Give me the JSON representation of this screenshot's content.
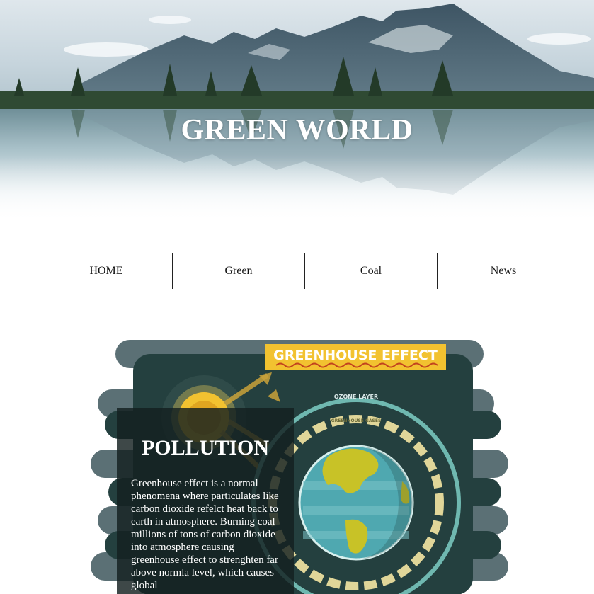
{
  "header": {
    "title": "GREEN WORLD"
  },
  "nav": {
    "items": [
      {
        "label": "HOME"
      },
      {
        "label": "Green"
      },
      {
        "label": "Coal"
      },
      {
        "label": "News"
      }
    ]
  },
  "infographic": {
    "banner": "GREENHOUSE EFFECT",
    "ozone_label": "OZONE LAYER",
    "gases_label": "GREENHOUSE GASES"
  },
  "article": {
    "title": "POLLUTION",
    "body": "Greenhouse effect is a normal phenomena where particulates like carbon dioxide refelct heat back to earth in atmosphere. Burning coal millions of tons of carbon dioxide into atmosphere causing greenhouse effect to strenghten far above normla level, which causes global"
  },
  "colors": {
    "banner_yellow": "#f2c230",
    "dark_teal": "#24403f",
    "ocean": "#4fa8b0",
    "land": "#c8c227"
  }
}
